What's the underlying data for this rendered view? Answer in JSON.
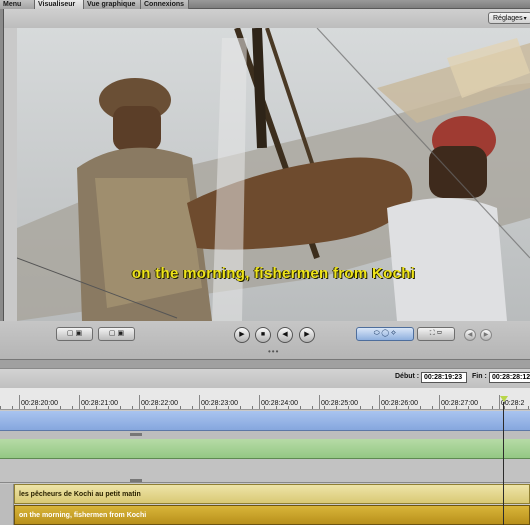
{
  "tabs": [
    {
      "label": "Menu",
      "active": false
    },
    {
      "label": "Visualiseur",
      "active": true
    },
    {
      "label": "Vue graphique",
      "active": false
    },
    {
      "label": "Connexions",
      "active": false
    }
  ],
  "viewer": {
    "settings_label": "Réglages",
    "subtitle_overlay": "on the morning, fishermen from Kochi"
  },
  "transport": {
    "play_icon": "play-icon",
    "stop_icon": "stop-icon",
    "prev_icon": "previous-frame-icon",
    "next_icon": "next-frame-icon",
    "accent": "#8fb0de"
  },
  "timeline": {
    "start_label": "Début :",
    "start_value": "00:28:19:23",
    "end_label": "Fin :",
    "end_value": "00:28:28:12",
    "ticks": [
      "00:28:20:00",
      "00:28:21:00",
      "00:28:22:00",
      "00:28:23:00",
      "00:28:24:00",
      "00:28:25:00",
      "00:28:26:00",
      "00:28:27:00",
      "00:28:2"
    ],
    "clips": {
      "french": "les pêcheurs de Kochi au petit matin",
      "english": "on the morning, fishermen from Kochi"
    },
    "colors": {
      "video_track": "#86a7de",
      "audio_track": "#94c884",
      "subtitle_fr": "#d9c975",
      "subtitle_en": "#b8901b",
      "playhead": "#b9d64a"
    }
  }
}
